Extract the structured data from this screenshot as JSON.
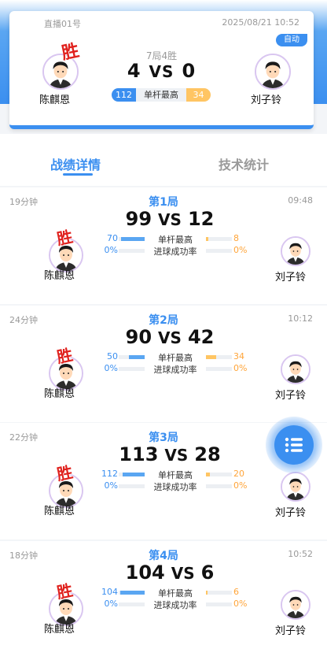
{
  "header": {
    "room_name": "直播01号",
    "match_time": "2025/08/21 10:52",
    "auto_badge": "自动",
    "rule": "7局4胜",
    "score_left": "4",
    "vs": "VS",
    "score_right": "0",
    "high_break_left": "112",
    "high_break_label": "单杆最高",
    "high_break_right": "34",
    "win_mark": "胜",
    "player_left": "陈麒恩",
    "player_right": "刘子铃"
  },
  "tabs": [
    {
      "label": "战绩详情",
      "active": true
    },
    {
      "label": "技术统计",
      "active": false
    }
  ],
  "games": [
    {
      "title": "第1局",
      "duration": "19分钟",
      "time": "09:48",
      "score_left": "99",
      "vs": "VS",
      "score_right": "12",
      "stats": [
        {
          "label": "单杆最高",
          "left": "70",
          "right": "8",
          "left_frac": 0.9,
          "right_frac": 0.1
        },
        {
          "label": "进球成功率",
          "left": "0%",
          "right": "0%",
          "left_frac": 0,
          "right_frac": 0
        }
      ],
      "winner": "left",
      "win_mark": "胜",
      "player_left": "陈麒恩",
      "player_right": "刘子铃"
    },
    {
      "title": "第2局",
      "duration": "24分钟",
      "time": "10:12",
      "score_left": "90",
      "vs": "VS",
      "score_right": "42",
      "stats": [
        {
          "label": "单杆最高",
          "left": "50",
          "right": "34",
          "left_frac": 0.6,
          "right_frac": 0.4
        },
        {
          "label": "进球成功率",
          "left": "0%",
          "right": "0%",
          "left_frac": 0,
          "right_frac": 0
        }
      ],
      "winner": "left",
      "win_mark": "胜",
      "player_left": "陈麒恩",
      "player_right": "刘子铃"
    },
    {
      "title": "第3局",
      "duration": "22分钟",
      "time": "",
      "score_left": "113",
      "vs": "VS",
      "score_right": "28",
      "stats": [
        {
          "label": "单杆最高",
          "left": "112",
          "right": "20",
          "left_frac": 0.85,
          "right_frac": 0.15
        },
        {
          "label": "进球成功率",
          "left": "0%",
          "right": "0%",
          "left_frac": 0,
          "right_frac": 0
        }
      ],
      "winner": "left",
      "win_mark": "胜",
      "player_left": "陈麒恩",
      "player_right": "刘子铃"
    },
    {
      "title": "第4局",
      "duration": "18分钟",
      "time": "10:52",
      "score_left": "104",
      "vs": "VS",
      "score_right": "6",
      "stats": [
        {
          "label": "单杆最高",
          "left": "104",
          "right": "6",
          "left_frac": 0.95,
          "right_frac": 0.05
        },
        {
          "label": "进球成功率",
          "left": "0%",
          "right": "0%",
          "left_frac": 0,
          "right_frac": 0
        }
      ],
      "winner": "left",
      "win_mark": "胜",
      "player_left": "陈麒恩",
      "player_right": "刘子铃"
    }
  ],
  "fab": {
    "icon": "list-icon"
  },
  "colors": {
    "primary": "#3b8ff0",
    "accent": "#ffc563",
    "win": "#e0221e"
  }
}
